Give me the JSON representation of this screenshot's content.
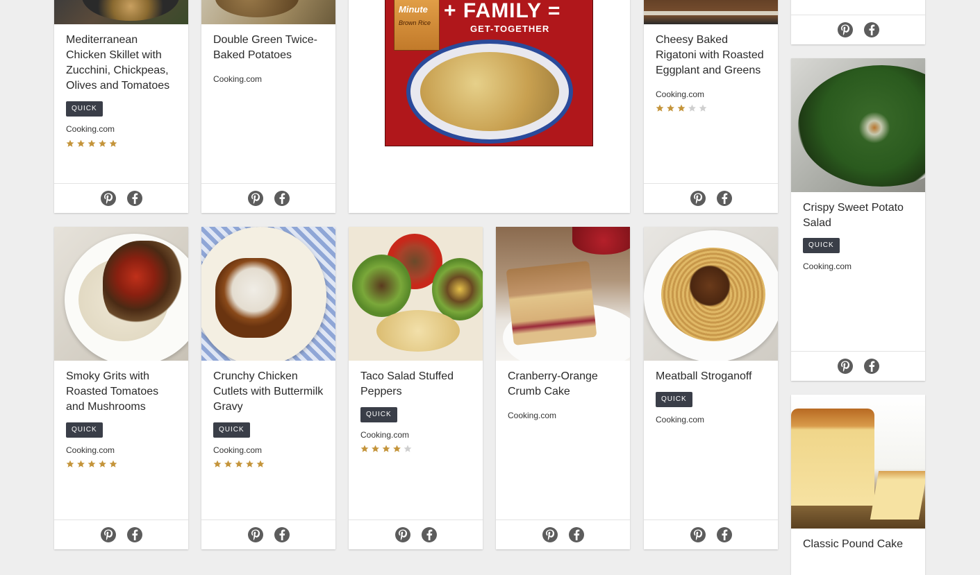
{
  "colors": {
    "background": "#eeeeee",
    "badge": "#3a3e48",
    "star_on": "#c4943a",
    "star_off": "#cfcfcf",
    "icon": "#5c5c5c"
  },
  "social": [
    "pinterest-icon",
    "facebook-icon"
  ],
  "ad": {
    "brand": "Minute",
    "product": "Brown Rice",
    "headline": "+ FAMILY =",
    "subheadline": "GET-TOGETHER"
  },
  "recipes": [
    {
      "title": "Mediterranean Chicken Skillet with Zucchini, Chickpeas, Olives and Tomatoes",
      "badge": "QUICK",
      "source": "Cooking.com",
      "rating": 5
    },
    {
      "title": "Double Green Twice-Baked Potatoes",
      "badge": "",
      "source": "Cooking.com",
      "rating": 0
    },
    {
      "title": "Cheesy Baked Rigatoni with Roasted Eggplant and Greens",
      "badge": "",
      "source": "Cooking.com",
      "rating": 3
    },
    {
      "title": "Crispy Sweet Potato Salad",
      "badge": "QUICK",
      "source": "Cooking.com",
      "rating": 0
    },
    {
      "title": "Smoky Grits with Roasted Tomatoes and Mushrooms",
      "badge": "QUICK",
      "source": "Cooking.com",
      "rating": 5
    },
    {
      "title": "Crunchy Chicken Cutlets with Buttermilk Gravy",
      "badge": "QUICK",
      "source": "Cooking.com",
      "rating": 5
    },
    {
      "title": "Taco Salad Stuffed Peppers",
      "badge": "QUICK",
      "source": "Cooking.com",
      "rating": 4
    },
    {
      "title": "Cranberry-Orange Crumb Cake",
      "badge": "",
      "source": "Cooking.com",
      "rating": 0
    },
    {
      "title": "Meatball Stroganoff",
      "badge": "QUICK",
      "source": "Cooking.com",
      "rating": 0
    },
    {
      "title": "Classic Pound Cake",
      "badge": "",
      "source": "",
      "rating": 0
    }
  ]
}
